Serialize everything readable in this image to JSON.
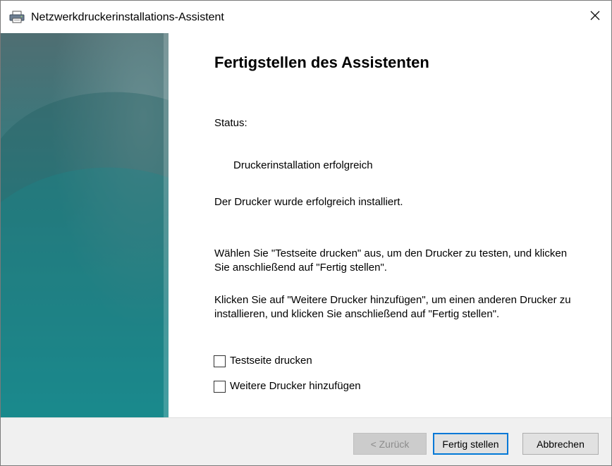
{
  "window": {
    "title": "Netzwerkdruckerinstallations-Assistent",
    "close_label": "×"
  },
  "content": {
    "heading": "Fertigstellen des Assistenten",
    "status_label": "Status:",
    "status_value": "Druckerinstallation erfolgreich",
    "installed_message": "Der Drucker wurde erfolgreich installiert.",
    "instruction_test": "Wählen Sie \"Testseite drucken\" aus, um den Drucker zu testen, und klicken Sie anschließend auf \"Fertig stellen\".",
    "instruction_more": "Klicken Sie auf \"Weitere Drucker hinzufügen\", um einen anderen Drucker zu installieren, und klicken Sie anschließend auf \"Fertig stellen\".",
    "checkboxes": [
      {
        "label": "Testseite drucken",
        "checked": false
      },
      {
        "label": "Weitere Drucker hinzufügen",
        "checked": false
      }
    ]
  },
  "footer": {
    "back_label": "< Zurück",
    "back_enabled": false,
    "finish_label": "Fertig stellen",
    "cancel_label": "Abbrechen"
  },
  "colors": {
    "sidebar_top": "#4f6e72",
    "sidebar_bottom": "#1aa0a4",
    "focus_border": "#0078d7",
    "footer_bg": "#f0f0f0"
  },
  "icons": {
    "title": "printer-icon",
    "close": "close-icon"
  }
}
